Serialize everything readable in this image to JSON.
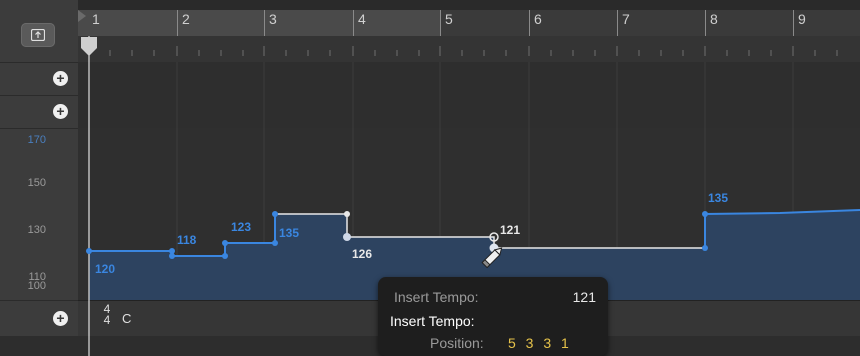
{
  "ruler": {
    "bars": [
      "1",
      "2",
      "3",
      "4",
      "5",
      "6",
      "7",
      "8",
      "9"
    ]
  },
  "tempo_track": {
    "axis_labels": {
      "top": "170",
      "l150": "150",
      "l130": "130",
      "l110": "110",
      "l100": "100"
    },
    "point_labels": {
      "p120": "120",
      "p118": "118",
      "p123": "123",
      "p135a": "135",
      "p126": "126",
      "p121": "121",
      "p135b": "135"
    }
  },
  "signature": {
    "numerator": "4",
    "denominator": "4",
    "key": "C"
  },
  "tooltip": {
    "line1_label": "Insert Tempo:",
    "line1_value": "121",
    "line2_label": "Insert Tempo:",
    "position_label": "Position:",
    "position_value": "5 3 3 1"
  },
  "colors": {
    "accent": "#3a86e0",
    "position_text": "#e6c34a"
  }
}
